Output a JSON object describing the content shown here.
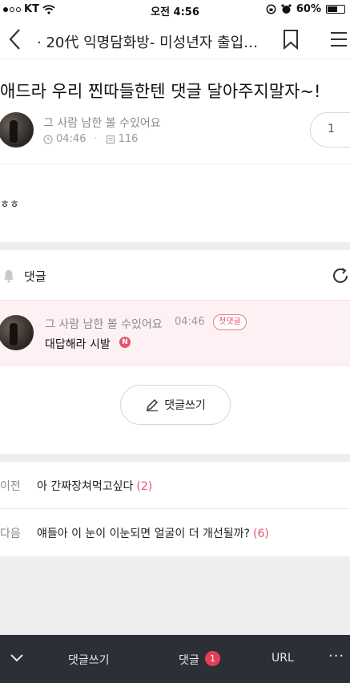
{
  "status_bar": {
    "carrier": "KT",
    "time": "오전 4:56",
    "battery": "60%"
  },
  "nav": {
    "title": "· 20代 익명담화방- 미성년자 출입…"
  },
  "post": {
    "title": "애드라 우리 찐따들한텐 댓글 달아주지말자~!",
    "author": "그 사람 남한 볼 수있어요",
    "time": "04:46",
    "views": "116",
    "comment_count": "1",
    "body": "ㅎㅎ"
  },
  "comments": {
    "header": "댓글",
    "items": [
      {
        "author": "그 사람 남한 볼 수있어요",
        "time": "04:46",
        "badge": "첫댓글",
        "text": "대답해라 시발",
        "new_badge": "N"
      }
    ],
    "write_label": "댓글쓰기"
  },
  "adjacent": {
    "prev": {
      "label": "이전",
      "title": "아 간짜장쳐먹고싶다",
      "count": "(2)"
    },
    "next": {
      "label": "다음",
      "title": "얘들아 이 눈이 이눈되면 얼굴이 더 개선될까?",
      "count": "(6)"
    }
  },
  "bottom_bar": {
    "write": "댓글쓰기",
    "comments": "댓글",
    "comment_badge": "1",
    "url": "URL",
    "more": "···"
  },
  "colors": {
    "accent": "#e2566b",
    "comment_bg": "#fdf1f3",
    "bottom_bar": "#2c2f36"
  }
}
